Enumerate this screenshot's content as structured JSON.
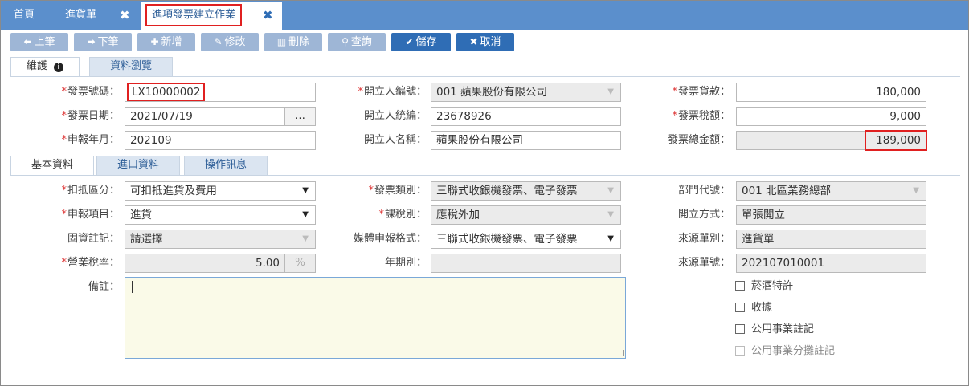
{
  "top_tabs": {
    "home": "首頁",
    "purchase_order": "進貨單",
    "active": "進項發票建立作業",
    "close_glyph": "✖"
  },
  "toolbar": {
    "prev": "上筆",
    "next": "下筆",
    "add": "新增",
    "edit": "修改",
    "delete": "刪除",
    "query": "查詢",
    "save": "儲存",
    "cancel": "取消"
  },
  "main_tabs": {
    "maintain": "維護",
    "browse": "資料瀏覽"
  },
  "header_fields": {
    "invoice_no": {
      "label": "發票號碼：",
      "value": "LX10000002"
    },
    "invoice_date": {
      "label": "發票日期：",
      "value": "2021/07/19",
      "button": "..."
    },
    "report_month": {
      "label": "申報年月：",
      "value": "202109"
    },
    "issuer_code": {
      "label": "開立人編號：",
      "value": "001 蘋果股份有限公司"
    },
    "issuer_tax_id": {
      "label": "開立人統編：",
      "value": "23678926"
    },
    "issuer_name": {
      "label": "開立人名稱：",
      "value": "蘋果股份有限公司"
    },
    "invoice_amount": {
      "label": "發票貨款：",
      "value": "180,000"
    },
    "invoice_tax": {
      "label": "發票稅額：",
      "value": "9,000"
    },
    "invoice_total": {
      "label": "發票總金額：",
      "value": "189,000"
    }
  },
  "sub_tabs": {
    "basic": "基本資料",
    "import": "進口資料",
    "log": "操作訊息"
  },
  "basic": {
    "deduct_type": {
      "label": "扣抵區分：",
      "value": "可扣抵進貨及費用"
    },
    "report_item": {
      "label": "申報項目：",
      "value": "進貨"
    },
    "fixed_asset": {
      "label": "固資註記：",
      "value": "請選擇"
    },
    "business_tax_rate": {
      "label": "營業稅率：",
      "value": "5.00",
      "unit": "%"
    },
    "remark": {
      "label": "備註："
    },
    "invoice_type": {
      "label": "發票類別：",
      "value": "三聯式收銀機發票、電子發票"
    },
    "tax_type": {
      "label": "課稅別：",
      "value": "應稅外加"
    },
    "media_format": {
      "label": "媒體申報格式：",
      "value": "三聯式收銀機發票、電子發票"
    },
    "period": {
      "label": "年期別：",
      "value": ""
    },
    "department": {
      "label": "部門代號：",
      "value": "001 北區業務總部"
    },
    "issue_method": {
      "label": "開立方式：",
      "value": "單張開立"
    },
    "source_type": {
      "label": "來源單別：",
      "value": "進貨單"
    },
    "source_no": {
      "label": "來源單號：",
      "value": "202107010001"
    },
    "checks": {
      "tobacco": "菸酒特許",
      "receipt": "收據",
      "utility": "公用事業註記",
      "utility_split": "公用事業分攤註記"
    }
  }
}
